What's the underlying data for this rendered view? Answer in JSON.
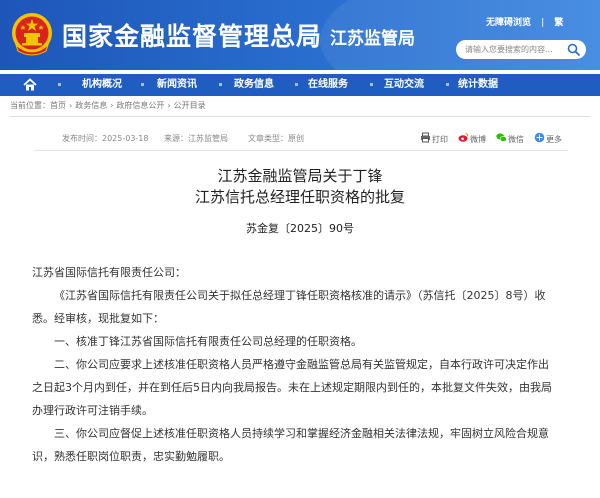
{
  "header": {
    "site_title": "国家金融监督管理总局",
    "branch_title": "江苏监管局",
    "accessibility_link": "无障碍浏览",
    "traditional_link": "繁",
    "search_placeholder": "请输入您要搜索的内容..."
  },
  "nav": {
    "items": [
      "机构概况",
      "新闻资讯",
      "政务信息",
      "在线服务",
      "互动交流",
      "统计数据"
    ]
  },
  "breadcrumb": {
    "prefix": "当前位置：",
    "items": [
      "首页",
      "政务信息",
      "政府信息公开",
      "公开目录"
    ]
  },
  "meta": {
    "date": "发布时间：2025-03-18",
    "source": "来源：江苏监管局",
    "type": "文章类型：原创",
    "print": "打印",
    "weibo": "微博",
    "wechat": "微信",
    "more": "更多"
  },
  "document": {
    "title_line1": "江苏金融监管局关于丁锋",
    "title_line2": "江苏信托总经理任职资格的批复",
    "doc_number": "苏金复〔2025〕90号",
    "addressee": "江苏省国际信托有限责任公司：",
    "p1_line1": "《江苏省国际信托有限责任公司关于拟任总经理丁锋任职资格核准的请示》（苏信托〔2025〕8号）收",
    "p1_line2": "悉。经审核，现批复如下：",
    "item1": "一、核准丁锋江苏省国际信托有限责任公司总经理的任职资格。",
    "item2_line1": "二、你公司应要求上述核准任职资格人员严格遵守金融监管总局有关监管规定，自本行政许可决定作出",
    "item2_line2": "之日起3个月内到任，并在到任后5日内向我局报告。未在上述规定期限内到任的，本批复文件失效，由我局",
    "item2_line3": "办理行政许可注销手续。",
    "item3_line1": "三、你公司应督促上述核准任职资格人员持续学习和掌握经济金融相关法律法规，牢固树立风险合规意",
    "item3_line2": "识，熟悉任职岗位职责，忠实勤勉履职。"
  },
  "colors": {
    "header_blue": "#2a6fd0",
    "nav_blue": "#1f5ec0",
    "emblem_red": "#d9231d",
    "emblem_gold": "#f5c400"
  }
}
